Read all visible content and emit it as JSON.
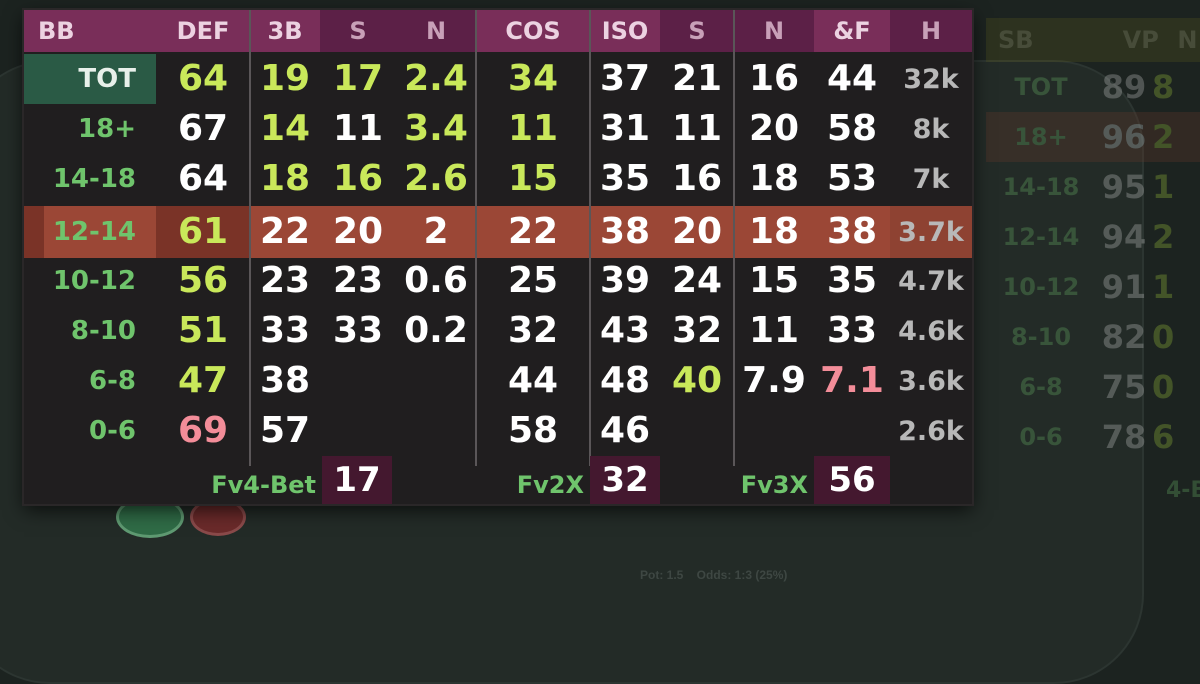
{
  "hud": {
    "headers": [
      "BB",
      "DEF",
      "3B",
      "S",
      "N",
      "COS",
      "ISO",
      "S",
      "N",
      "&F",
      "H"
    ],
    "rows": [
      {
        "label": "TOT",
        "values": [
          "64",
          "19",
          "17",
          "2.4",
          "34",
          "37",
          "21",
          "16",
          "44",
          "32k"
        ]
      },
      {
        "label": "18+",
        "values": [
          "67",
          "14",
          "11",
          "3.4",
          "11",
          "31",
          "11",
          "20",
          "58",
          "8k"
        ]
      },
      {
        "label": "14-18",
        "values": [
          "64",
          "18",
          "16",
          "2.6",
          "15",
          "35",
          "16",
          "18",
          "53",
          "7k"
        ]
      },
      {
        "label": "12-14",
        "values": [
          "61",
          "22",
          "20",
          "2",
          "22",
          "38",
          "20",
          "18",
          "38",
          "3.7k"
        ]
      },
      {
        "label": "10-12",
        "values": [
          "56",
          "23",
          "23",
          "0.6",
          "25",
          "39",
          "24",
          "15",
          "35",
          "4.7k"
        ]
      },
      {
        "label": "8-10",
        "values": [
          "51",
          "33",
          "33",
          "0.2",
          "32",
          "43",
          "32",
          "11",
          "33",
          "4.6k"
        ]
      },
      {
        "label": "6-8",
        "values": [
          "47",
          "38",
          "",
          "",
          "44",
          "48",
          "40",
          "7.9",
          "7.1",
          "3.6k"
        ]
      },
      {
        "label": "0-6",
        "values": [
          "69",
          "57",
          "",
          "",
          "58",
          "46",
          "",
          "",
          "",
          "2.6k"
        ]
      }
    ],
    "footer": [
      {
        "label": "Fv4-Bet",
        "value": "17"
      },
      {
        "label": "Fv2X",
        "value": "32"
      },
      {
        "label": "Fv3X",
        "value": "56"
      }
    ],
    "colors": {
      "header": "#792e59",
      "header_dim": "#5c2047",
      "highlight_row": "#9b4736",
      "good": "#c9e85a",
      "bad": "#f38d99",
      "neutral": "#ffffff",
      "label": "#6fc46c"
    }
  },
  "background": {
    "pot_text": "Pot: 1.5    Odds: 1:3 (25%)",
    "ghost_hud": {
      "headers": [
        "SB",
        "VP",
        "N"
      ],
      "rows": [
        {
          "label": "TOT",
          "values": [
            "89",
            "8"
          ]
        },
        {
          "label": "18+",
          "values": [
            "96",
            "2"
          ]
        },
        {
          "label": "14-18",
          "values": [
            "95",
            "1"
          ]
        },
        {
          "label": "12-14",
          "values": [
            "94",
            "2"
          ]
        },
        {
          "label": "10-12",
          "values": [
            "91",
            "1"
          ]
        },
        {
          "label": "8-10",
          "values": [
            "82",
            "0"
          ]
        },
        {
          "label": "6-8",
          "values": [
            "75",
            "0"
          ]
        },
        {
          "label": "0-6",
          "values": [
            "78",
            "6"
          ]
        }
      ],
      "footer": "4-B"
    }
  }
}
